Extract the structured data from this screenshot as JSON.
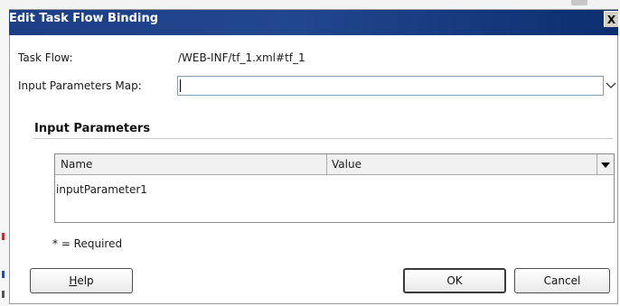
{
  "dialog": {
    "title": "Edit Task Flow Binding",
    "close_label": "X"
  },
  "task_flow": {
    "label": "Task Flow:",
    "value": "/WEB-INF/tf_1.xml#tf_1"
  },
  "input_parameters_map": {
    "label": "Input Parameters Map:",
    "value": ""
  },
  "input_parameters": {
    "section_title": "Input Parameters",
    "columns": [
      "Name",
      "Value"
    ],
    "rows": [
      {
        "name": "inputParameter1",
        "value": ""
      }
    ]
  },
  "required_note": "* = Required",
  "buttons": {
    "help_mnemonic": "H",
    "help_rest": "elp",
    "ok": "OK",
    "cancel": "Cancel"
  },
  "colors": {
    "titlebar": "#21478f",
    "field_border": "#7f9db9"
  }
}
